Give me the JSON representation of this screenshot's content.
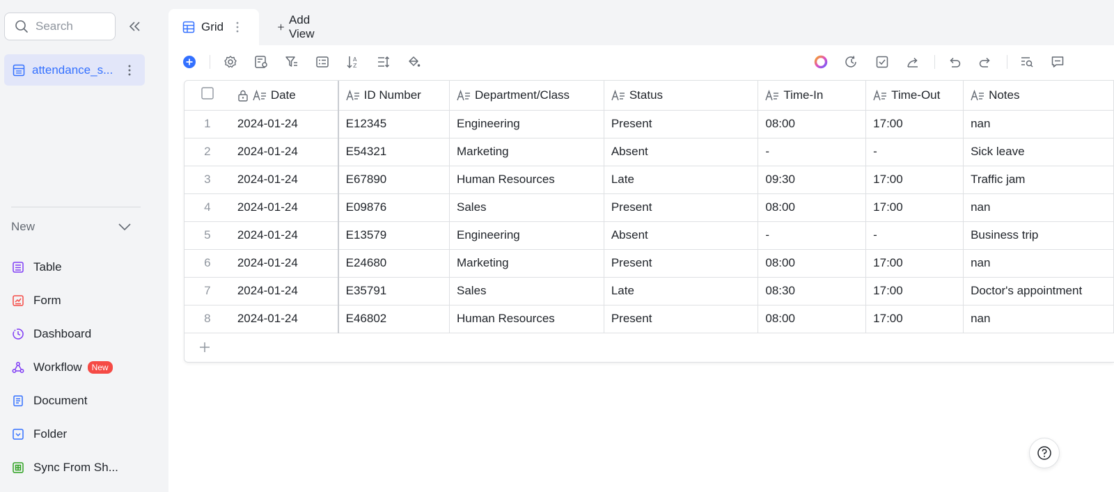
{
  "sidebar": {
    "search_placeholder": "Search",
    "table_name": "attendance_s...",
    "new_label": "New",
    "new_items": [
      {
        "label": "Table",
        "icon": "table-icon",
        "color": "#7f3bf5"
      },
      {
        "label": "Form",
        "icon": "form-icon",
        "color": "#f54a45"
      },
      {
        "label": "Dashboard",
        "icon": "dashboard-icon",
        "color": "#7f3bf5"
      },
      {
        "label": "Workflow",
        "icon": "workflow-icon",
        "color": "#7f3bf5",
        "badge": "New"
      },
      {
        "label": "Document",
        "icon": "document-icon",
        "color": "#3370ff"
      },
      {
        "label": "Folder",
        "icon": "folder-icon",
        "color": "#3370ff"
      },
      {
        "label": "Sync From Sh...",
        "icon": "sync-sheet-icon",
        "color": "#2ea121"
      }
    ]
  },
  "tabs": {
    "grid_label": "Grid",
    "add_view_label": "Add View"
  },
  "grid": {
    "columns": [
      "Date",
      "ID Number",
      "Department/Class",
      "Status",
      "Time-In",
      "Time-Out",
      "Notes"
    ],
    "rows": [
      {
        "n": "1",
        "cells": [
          "2024-01-24",
          "E12345",
          "Engineering",
          "Present",
          "08:00",
          "17:00",
          "nan"
        ]
      },
      {
        "n": "2",
        "cells": [
          "2024-01-24",
          "E54321",
          "Marketing",
          "Absent",
          "-",
          "-",
          "Sick leave"
        ]
      },
      {
        "n": "3",
        "cells": [
          "2024-01-24",
          "E67890",
          "Human Resources",
          "Late",
          "09:30",
          "17:00",
          "Traffic jam"
        ]
      },
      {
        "n": "4",
        "cells": [
          "2024-01-24",
          "E09876",
          "Sales",
          "Present",
          "08:00",
          "17:00",
          "nan"
        ]
      },
      {
        "n": "5",
        "cells": [
          "2024-01-24",
          "E13579",
          "Engineering",
          "Absent",
          "-",
          "-",
          "Business trip"
        ]
      },
      {
        "n": "6",
        "cells": [
          "2024-01-24",
          "E24680",
          "Marketing",
          "Present",
          "08:00",
          "17:00",
          "nan"
        ]
      },
      {
        "n": "7",
        "cells": [
          "2024-01-24",
          "E35791",
          "Sales",
          "Late",
          "08:30",
          "17:00",
          "Doctor's appointment"
        ]
      },
      {
        "n": "8",
        "cells": [
          "2024-01-24",
          "E46802",
          "Human Resources",
          "Present",
          "08:00",
          "17:00",
          "nan"
        ]
      }
    ]
  },
  "colors": {
    "accent": "#3370ff",
    "selected_bg": "#e2e6f9"
  }
}
